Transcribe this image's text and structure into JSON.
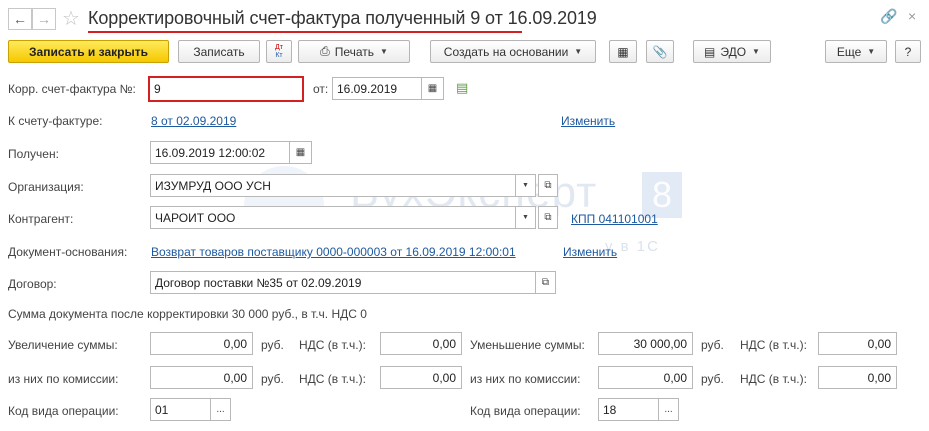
{
  "window": {
    "title_main": "Корректировочный счет-фактура полученный",
    "title_num": "9 от 16.09.2019"
  },
  "toolbar": {
    "save_close": "Записать и закрыть",
    "save": "Записать",
    "dtkt_top": "Дт",
    "dtkt_bottom": "Кт",
    "print": "Печать",
    "create_based": "Создать на основании",
    "edo": "ЭДО",
    "more": "Еще",
    "help": "?"
  },
  "form": {
    "corr_invoice_label": "Корр. счет-фактура №:",
    "corr_invoice_value": "9",
    "date_label": "от:",
    "date_value": "16.09.2019",
    "to_invoice_label": "К счету-фактуре:",
    "to_invoice_link": "8 от 02.09.2019",
    "change1": "Изменить",
    "received_label": "Получен:",
    "received_value": "16.09.2019 12:00:02",
    "org_label": "Организация:",
    "org_value": "ИЗУМРУД ООО УСН",
    "contractor_label": "Контрагент:",
    "contractor_value": "ЧАРОИТ ООО",
    "kpp_link": "КПП 041101001",
    "basis_label": "Документ-основания:",
    "basis_link": "Возврат товаров поставщику 0000-000003 от 16.09.2019 12:00:01",
    "change2": "Изменить",
    "contract_label": "Договор:",
    "contract_value": "Договор поставки №35 от 02.09.2019",
    "sum_text": "Сумма документа после корректировки 30 000 руб., в т.ч. НДС 0",
    "increase_label": "Увеличение суммы:",
    "increase_value": "0,00",
    "rub": "руб.",
    "vat_label": "НДС (в т.ч.):",
    "increase_vat": "0,00",
    "decrease_label": "Уменьшение суммы:",
    "decrease_value": "30 000,00",
    "decrease_vat": "0,00",
    "commission_label": "из них по комиссии:",
    "inc_comm_value": "0,00",
    "inc_comm_vat": "0,00",
    "dec_comm_value": "0,00",
    "dec_comm_vat": "0,00",
    "op_code_label": "Код вида операции:",
    "op_code_left": "01",
    "op_code_right": "18",
    "dots": "..."
  },
  "watermark": {
    "brand": "БухЭксперт",
    "digit": "8",
    "tagline": "у в 1С"
  },
  "colors": {
    "accent_red": "#d32020",
    "link": "#1e5aa0",
    "primary_btn": "#f5c800"
  }
}
